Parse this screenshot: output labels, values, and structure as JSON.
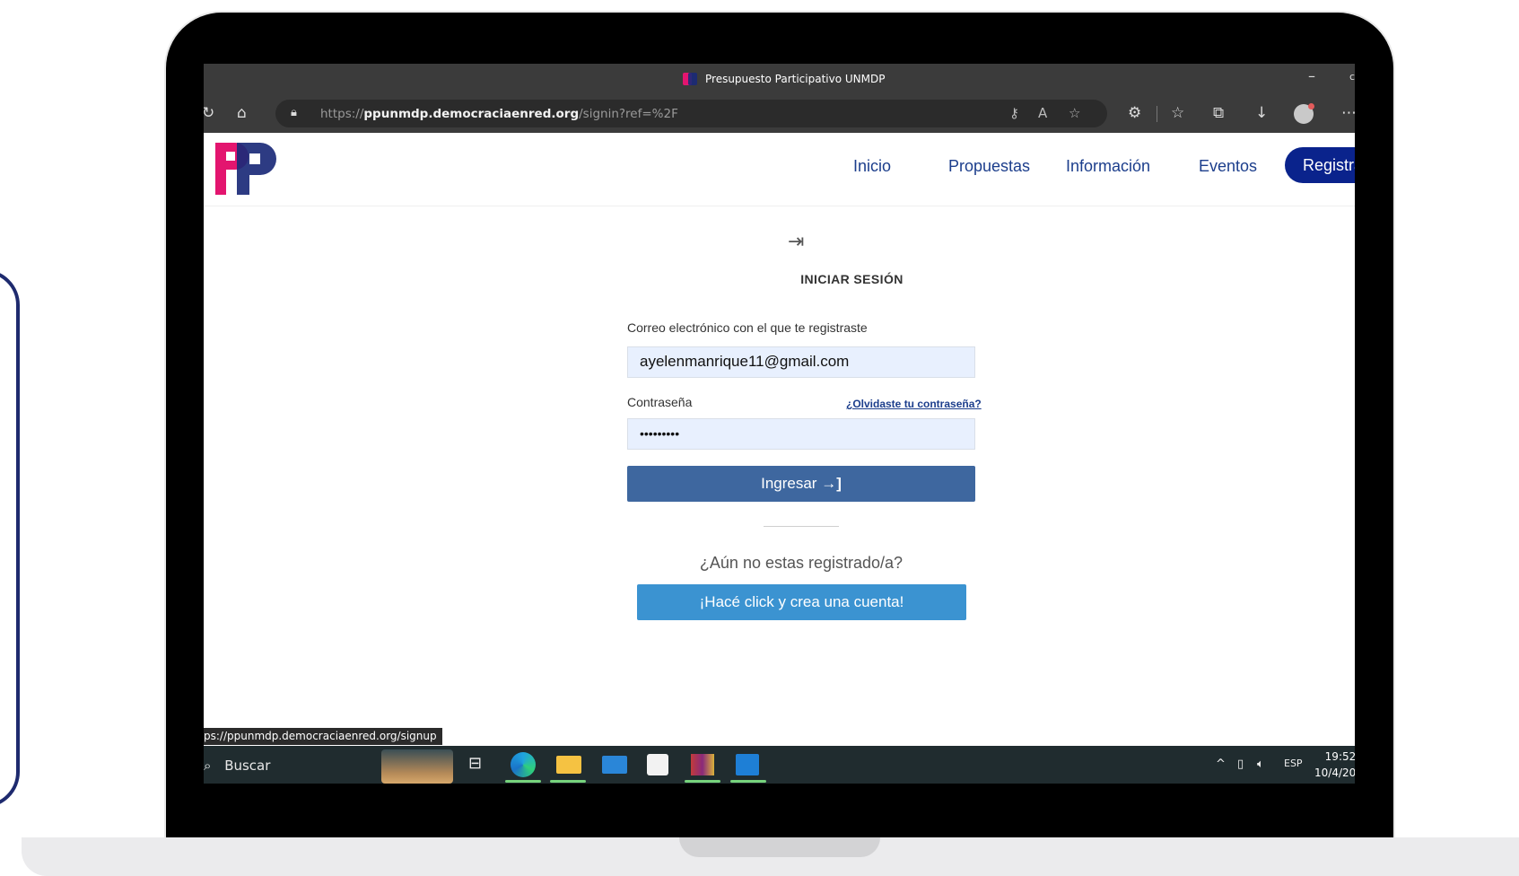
{
  "browser": {
    "window_title": "Presupuesto Participativo UNMDP",
    "url_prefix": "https://",
    "url_domain": "ppunmdp.democraciaenred.org",
    "url_path": "/signin?ref=%2F"
  },
  "site": {
    "nav": {
      "inicio": "Inicio",
      "propuestas": "Propuestas",
      "informacion": "Información",
      "eventos": "Eventos",
      "register": "Registrarse"
    },
    "colors": {
      "brand_pink": "#e3156f",
      "brand_navy": "#1b2a78",
      "primary": "#3e679f",
      "secondary": "#3b93d1"
    }
  },
  "signin": {
    "heading": "INICIAR SESIÓN",
    "email_label": "Correo electrónico con el que te registraste",
    "email_value": "ayelenmanrique11@gmail.com",
    "password_label": "Contraseña",
    "password_value": "•••••••••",
    "forgot_link": "¿Olvidaste tu contraseña?",
    "submit_label": "Ingresar",
    "not_registered": "¿Aún no estas registrado/a?",
    "create_account": "¡Hacé click y crea una cuenta!"
  },
  "status_bar": {
    "link": "ps://ppunmdp.democraciaenred.org/signup"
  },
  "taskbar": {
    "search_label": "Buscar",
    "language": "ESP",
    "time": "19:52",
    "date": "10/4/20"
  }
}
